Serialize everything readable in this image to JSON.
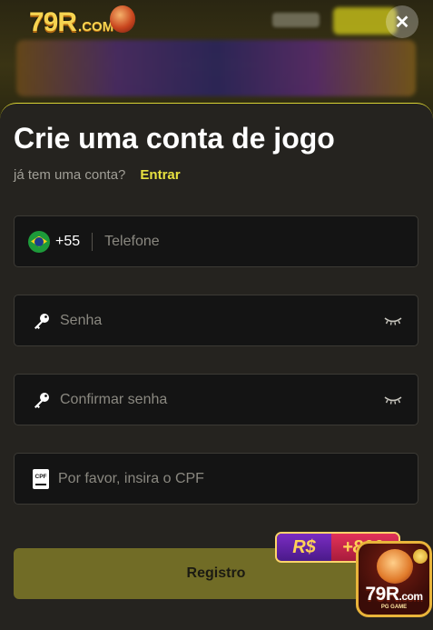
{
  "header": {
    "logo_text": "79R",
    "logo_domain": ".COM",
    "close_symbol": "✕"
  },
  "modal": {
    "title": "Crie uma conta de jogo",
    "has_account_text": "já tem uma conta?",
    "login_link": "Entrar",
    "phone": {
      "country_code": "+55",
      "placeholder": "Telefone",
      "flag_icon": "brazil-flag-icon"
    },
    "password": {
      "placeholder": "Senha",
      "icon": "key-icon",
      "visibility_icon": "eye-closed-icon"
    },
    "confirm_password": {
      "placeholder": "Confirmar senha",
      "icon": "key-icon",
      "visibility_icon": "eye-closed-icon"
    },
    "cpf": {
      "icon_label": "CPF",
      "placeholder": "Por favor, insira o CPF"
    },
    "register_button": "Registro"
  },
  "promo": {
    "currency": "R$",
    "bonus": "+800",
    "app_brand": "79R",
    "app_brand_suffix": ".com",
    "app_tag": "PG GAME"
  },
  "colors": {
    "accent": "#e8e240",
    "sheet_border": "#d8d232",
    "register_button_bg": "#716c26",
    "field_bg": "#141414",
    "sheet_bg": "#25231f"
  }
}
